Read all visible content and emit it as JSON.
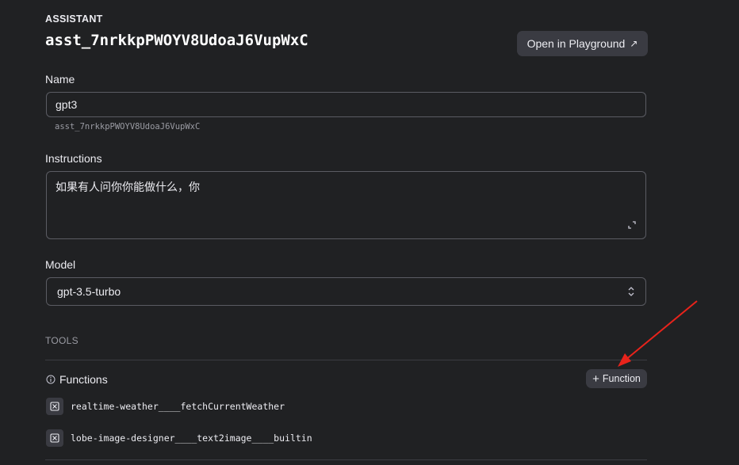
{
  "header": {
    "eyebrow": "ASSISTANT",
    "assistant_id": "asst_7nrkkpPWOYV8UdoaJ6VupWxC",
    "playground_button": "Open in Playground",
    "playground_icon": "external-arrow-icon"
  },
  "name_field": {
    "label": "Name",
    "value": "gpt3",
    "id_caption": "asst_7nrkkpPWOYV8UdoaJ6VupWxC"
  },
  "instructions_field": {
    "label": "Instructions",
    "value": "如果有人问你你能做什么，你"
  },
  "model_field": {
    "label": "Model",
    "value": "gpt-3.5-turbo"
  },
  "tools": {
    "heading": "TOOLS",
    "functions_label": "Functions",
    "add_function_button": "Function",
    "functions": [
      {
        "name": "realtime-weather____fetchCurrentWeather"
      },
      {
        "name": "lobe-image-designer____text2image____builtin"
      }
    ]
  },
  "annotation": {
    "arrow_color": "#e8231b"
  },
  "colors": {
    "background": "#202123",
    "border": "#5b5c63",
    "button_bg": "#3a3b42"
  }
}
